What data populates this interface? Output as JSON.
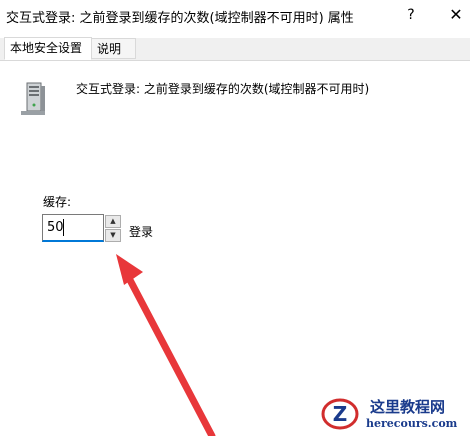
{
  "window": {
    "title": "交互式登录: 之前登录到缓存的次数(域控制器不可用时) 属性",
    "help_label": "?",
    "close_label": "✕"
  },
  "tabs": [
    {
      "label": "本地安全设置",
      "active": true
    },
    {
      "label": "说明",
      "active": false
    }
  ],
  "policy": {
    "icon": "server-icon",
    "title": "交互式登录: 之前登录到缓存的次数(域控制器不可用时)"
  },
  "cache": {
    "label": "缓存:",
    "value": "50",
    "unit": "登录",
    "up_glyph": "▲",
    "down_glyph": "▼"
  },
  "annotation": {
    "color": "#e8373a"
  },
  "watermark": {
    "title": "这里教程网",
    "url": "herecours.com",
    "logo_letter": "Z"
  }
}
